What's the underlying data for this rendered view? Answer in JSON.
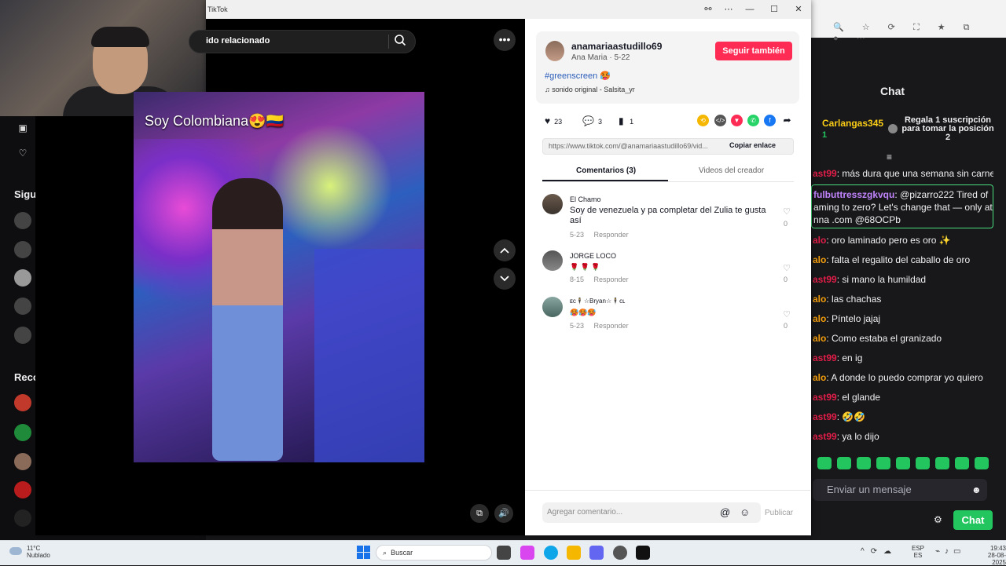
{
  "window": {
    "title": "TikTok",
    "controls": [
      "⋯",
      "—",
      "☐",
      "✕"
    ]
  },
  "search": {
    "text": "ido relacionado"
  },
  "video": {
    "caption": "Soy Colombiana😍🇨🇴"
  },
  "post": {
    "username": "anamariaastudillo69",
    "subtitle": "Ana Maria · 5-22",
    "follow_label": "Seguir también",
    "hashtag": "#greenscreen 🥵",
    "music": "♫  sonido original - Salsita_yr",
    "likes": "23",
    "comments": "3",
    "saves": "1",
    "link": "https://www.tiktok.com/@anamariaastudillo69/vid...",
    "copy_label": "Copiar enlace"
  },
  "tabs": [
    {
      "label": "Comentarios (3)"
    },
    {
      "label": "Videos del creador"
    }
  ],
  "comments": [
    {
      "name": "El Chamo",
      "text": "Soy de venezuela y pa completar del Zulia te gusta así",
      "date": "5-23",
      "reply": "Responder",
      "likes": "0"
    },
    {
      "name": "JORGE LOCO",
      "text": "🌹 🌹 🌹",
      "date": "8-15",
      "reply": "Responder",
      "likes": "0"
    },
    {
      "name": "ᴇᴄ🕴☆Bryan☆🕴ᴄʟ",
      "text": "🥵🥵🥵",
      "date": "5-23",
      "reply": "Responder",
      "likes": "0"
    }
  ],
  "comment_bar": {
    "placeholder": "Agregar comentario...",
    "publish": "Publicar"
  },
  "left_sidebar": {
    "section_following": "Sigu",
    "section_recommended": "Reco"
  },
  "chat": {
    "title": "Chat",
    "sub_user": "Carlangas345",
    "sub_count": "1",
    "sub_text": "Regala 1 suscripción para tomar la posición 2",
    "highlight_user": "fulbuttresszgkvqu",
    "highlight_text": ": @pizarro222 Tired of aming to zero? Let's change that — only at nna .com @68OCPb",
    "lines": [
      {
        "user": "ast99",
        "text": ": más dura que una semana sin carne"
      },
      {
        "user": "alo",
        "text": ": oro laminado pero es oro ✨"
      },
      {
        "user": "alo",
        "text": ": falta el regalito del caballo de oro"
      },
      {
        "user": "ast99",
        "text": ": si mano la humildad"
      },
      {
        "user": "alo",
        "text": ": las chachas"
      },
      {
        "user": "alo",
        "text": ": Píntelo jajaj"
      },
      {
        "user": "alo",
        "text": ": Como estaba el granizado"
      },
      {
        "user": "ast99",
        "text": ": en ig"
      },
      {
        "user": "alo",
        "text": ": A donde lo puedo comprar yo quiero"
      },
      {
        "user": "ast99",
        "text": ": el glande"
      },
      {
        "user": "ast99",
        "text": ": 🤣🤣"
      },
      {
        "user": "ast99",
        "text": ": ya lo dijo"
      }
    ],
    "input_placeholder": "Enviar un mensaje",
    "send_label": "Chat"
  },
  "taskbar": {
    "weather_temp": "11°C",
    "weather_desc": "Nublado",
    "search_label": "Buscar",
    "lang_top": "ESP",
    "lang_bottom": "ES",
    "time": "19:43",
    "date": "28-08-2025"
  },
  "colors": {
    "tiktok_red": "#fe2c55",
    "twitch_green": "#22c55e",
    "hashtag_blue": "#2b5db9"
  }
}
